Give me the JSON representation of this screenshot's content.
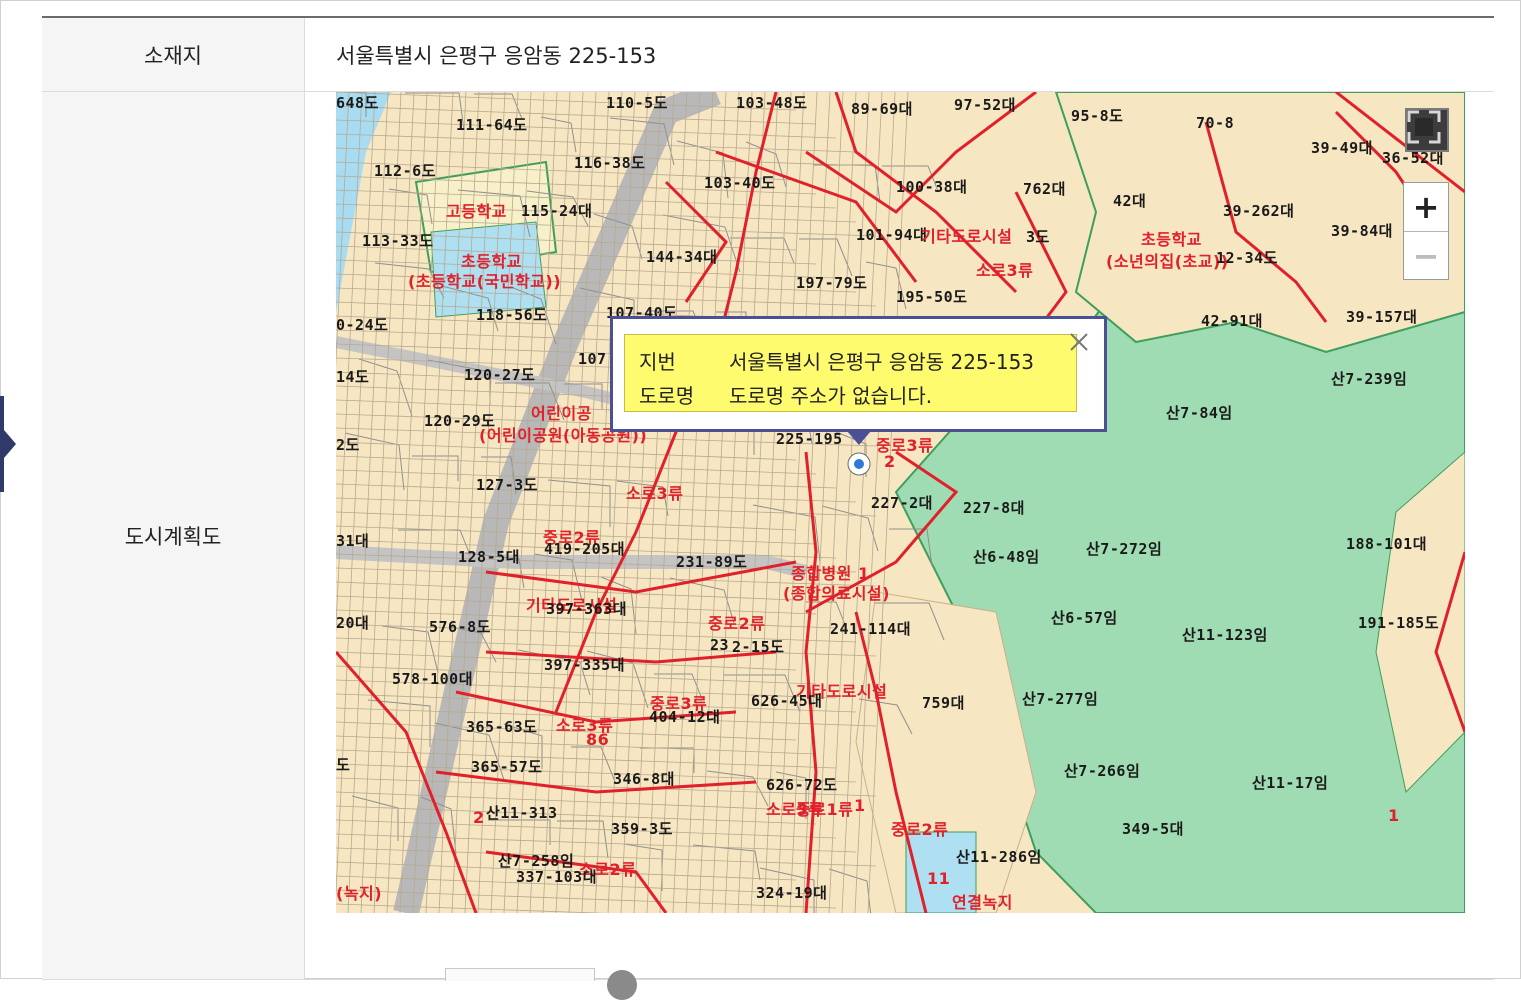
{
  "table": {
    "location_label": "소재지",
    "location_value": "서울특별시 은평구 응암동 225-153",
    "plan_label": "도시계획도"
  },
  "popup": {
    "jibun_label": "지번",
    "jibun_value": "서울특별시 은평구 응암동 225-153",
    "road_label": "도로명",
    "road_value": "도로명 주소가 없습니다."
  },
  "map_controls": {
    "zoom_in": "+",
    "zoom_out": "−"
  },
  "map_labels": [
    {
      "text": "110-5도",
      "red": false
    },
    {
      "text": "103-48도",
      "red": false
    },
    {
      "text": "89-69대",
      "red": false
    },
    {
      "text": "97-52대",
      "red": false
    },
    {
      "text": "95-8도",
      "red": false
    },
    {
      "text": "70-8",
      "red": false
    },
    {
      "text": "111-64도",
      "red": false
    },
    {
      "text": "39-49대",
      "red": false
    },
    {
      "text": "36-52대",
      "red": false
    },
    {
      "text": "112-6도",
      "red": false
    },
    {
      "text": "116-38도",
      "red": false
    },
    {
      "text": "103-40도",
      "red": false
    },
    {
      "text": "100-38대",
      "red": false
    },
    {
      "text": "762대",
      "red": false
    },
    {
      "text": "42대",
      "red": false
    },
    {
      "text": "고등학교",
      "red": true
    },
    {
      "text": "115-24대",
      "red": false
    },
    {
      "text": "39-262대",
      "red": false
    },
    {
      "text": "초등학교",
      "red": true
    },
    {
      "text": "(소년의집(초교))",
      "red": true
    },
    {
      "text": "113-33도",
      "red": false
    },
    {
      "text": "101-94대",
      "red": false
    },
    {
      "text": "기타도로시설",
      "red": true
    },
    {
      "text": "3도",
      "red": false
    },
    {
      "text": "39-84대",
      "red": false
    },
    {
      "text": "초등학교",
      "red": true
    },
    {
      "text": "(초등학교(국민학교))",
      "red": true
    },
    {
      "text": "144-34대",
      "red": false
    },
    {
      "text": "소로3류",
      "red": true
    },
    {
      "text": "12-34도",
      "red": false
    },
    {
      "text": "197-79도",
      "red": false
    },
    {
      "text": "195-50도",
      "red": false
    },
    {
      "text": "118-56도",
      "red": false
    },
    {
      "text": "107-40도",
      "red": false
    },
    {
      "text": "42-91대",
      "red": false
    },
    {
      "text": "39-157대",
      "red": false
    },
    {
      "text": "0-24도",
      "red": false
    },
    {
      "text": "107",
      "red": false
    },
    {
      "text": "120-27도",
      "red": false
    },
    {
      "text": "산7-239임",
      "red": false
    },
    {
      "text": "14도",
      "red": false
    },
    {
      "text": "어린이공",
      "red": true
    },
    {
      "text": "120-29도",
      "red": false
    },
    {
      "text": "(어린이공원(아동공원))",
      "red": true
    },
    {
      "text": "산7-84임",
      "red": false
    },
    {
      "text": "225-195",
      "red": false
    },
    {
      "text": "중로3류",
      "red": true
    },
    {
      "text": "2",
      "red": true
    },
    {
      "text": "2도",
      "red": false
    },
    {
      "text": "127-3도",
      "red": false
    },
    {
      "text": "소로3류",
      "red": true
    },
    {
      "text": "227-2대",
      "red": false
    },
    {
      "text": "227-8대",
      "red": false
    },
    {
      "text": "중로2류",
      "red": true
    },
    {
      "text": "31대",
      "red": false
    },
    {
      "text": "419-205대",
      "red": false
    },
    {
      "text": "128-5대",
      "red": false
    },
    {
      "text": "231-89도",
      "red": false
    },
    {
      "text": "산6-48임",
      "red": false
    },
    {
      "text": "산7-272임",
      "red": false
    },
    {
      "text": "188-101대",
      "red": false
    },
    {
      "text": "종합병원 1",
      "red": true
    },
    {
      "text": "(종합의료시설)",
      "red": true
    },
    {
      "text": "기타도로시설",
      "red": true
    },
    {
      "text": "397-363대",
      "red": false
    },
    {
      "text": "20대",
      "red": false
    },
    {
      "text": "576-8도",
      "red": false
    },
    {
      "text": "중로2류",
      "red": true
    },
    {
      "text": "241-114대",
      "red": false
    },
    {
      "text": "산6-57임",
      "red": false
    },
    {
      "text": "191-185도",
      "red": false
    },
    {
      "text": "23",
      "red": false
    },
    {
      "text": "2-15도",
      "red": false
    },
    {
      "text": "산11-123임",
      "red": false
    },
    {
      "text": "397-335대",
      "red": false
    },
    {
      "text": "578-100대",
      "red": false
    },
    {
      "text": "기타도로시설",
      "red": true
    },
    {
      "text": "중로3류",
      "red": true
    },
    {
      "text": "626-45대",
      "red": false
    },
    {
      "text": "759대",
      "red": false
    },
    {
      "text": "산7-277임",
      "red": false
    },
    {
      "text": "404-12대",
      "red": false
    },
    {
      "text": "365-63도",
      "red": false
    },
    {
      "text": "소로3류",
      "red": true
    },
    {
      "text": "86",
      "red": true
    },
    {
      "text": "도",
      "red": false
    },
    {
      "text": "365-57도",
      "red": false
    },
    {
      "text": "346-8대",
      "red": false
    },
    {
      "text": "산7-266임",
      "red": false
    },
    {
      "text": "산11-17임",
      "red": false
    },
    {
      "text": "626-72도",
      "red": false
    },
    {
      "text": "소로3류",
      "red": true
    },
    {
      "text": "중로1류",
      "red": true
    },
    {
      "text": "1",
      "red": true
    },
    {
      "text": "중로2류",
      "red": true
    },
    {
      "text": "1",
      "red": true
    },
    {
      "text": "산11-313",
      "red": false
    },
    {
      "text": "2",
      "red": true
    },
    {
      "text": "359-3도",
      "red": false
    },
    {
      "text": "349-5대",
      "red": false
    },
    {
      "text": "산11-286임",
      "red": false
    },
    {
      "text": "산7-258임",
      "red": false
    },
    {
      "text": "소로2류",
      "red": true
    },
    {
      "text": "337-103대",
      "red": false
    },
    {
      "text": "11",
      "red": true
    },
    {
      "text": "연결녹지",
      "red": true
    },
    {
      "text": "(녹지)",
      "red": true
    },
    {
      "text": "324-19대",
      "red": false
    },
    {
      "text": "648도",
      "red": false
    }
  ]
}
